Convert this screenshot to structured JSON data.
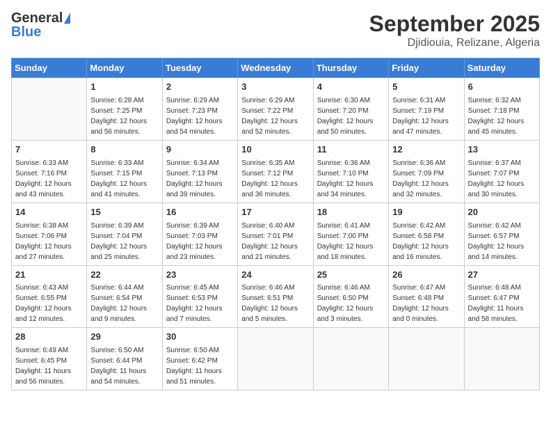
{
  "logo": {
    "general": "General",
    "blue": "Blue"
  },
  "title": "September 2025",
  "location": "Djidiouia, Relizane, Algeria",
  "days_of_week": [
    "Sunday",
    "Monday",
    "Tuesday",
    "Wednesday",
    "Thursday",
    "Friday",
    "Saturday"
  ],
  "weeks": [
    [
      {
        "day": "",
        "info": ""
      },
      {
        "day": "1",
        "info": "Sunrise: 6:28 AM\nSunset: 7:25 PM\nDaylight: 12 hours\nand 56 minutes."
      },
      {
        "day": "2",
        "info": "Sunrise: 6:29 AM\nSunset: 7:23 PM\nDaylight: 12 hours\nand 54 minutes."
      },
      {
        "day": "3",
        "info": "Sunrise: 6:29 AM\nSunset: 7:22 PM\nDaylight: 12 hours\nand 52 minutes."
      },
      {
        "day": "4",
        "info": "Sunrise: 6:30 AM\nSunset: 7:20 PM\nDaylight: 12 hours\nand 50 minutes."
      },
      {
        "day": "5",
        "info": "Sunrise: 6:31 AM\nSunset: 7:19 PM\nDaylight: 12 hours\nand 47 minutes."
      },
      {
        "day": "6",
        "info": "Sunrise: 6:32 AM\nSunset: 7:18 PM\nDaylight: 12 hours\nand 45 minutes."
      }
    ],
    [
      {
        "day": "7",
        "info": "Sunrise: 6:33 AM\nSunset: 7:16 PM\nDaylight: 12 hours\nand 43 minutes."
      },
      {
        "day": "8",
        "info": "Sunrise: 6:33 AM\nSunset: 7:15 PM\nDaylight: 12 hours\nand 41 minutes."
      },
      {
        "day": "9",
        "info": "Sunrise: 6:34 AM\nSunset: 7:13 PM\nDaylight: 12 hours\nand 39 minutes."
      },
      {
        "day": "10",
        "info": "Sunrise: 6:35 AM\nSunset: 7:12 PM\nDaylight: 12 hours\nand 36 minutes."
      },
      {
        "day": "11",
        "info": "Sunrise: 6:36 AM\nSunset: 7:10 PM\nDaylight: 12 hours\nand 34 minutes."
      },
      {
        "day": "12",
        "info": "Sunrise: 6:36 AM\nSunset: 7:09 PM\nDaylight: 12 hours\nand 32 minutes."
      },
      {
        "day": "13",
        "info": "Sunrise: 6:37 AM\nSunset: 7:07 PM\nDaylight: 12 hours\nand 30 minutes."
      }
    ],
    [
      {
        "day": "14",
        "info": "Sunrise: 6:38 AM\nSunset: 7:06 PM\nDaylight: 12 hours\nand 27 minutes."
      },
      {
        "day": "15",
        "info": "Sunrise: 6:39 AM\nSunset: 7:04 PM\nDaylight: 12 hours\nand 25 minutes."
      },
      {
        "day": "16",
        "info": "Sunrise: 6:39 AM\nSunset: 7:03 PM\nDaylight: 12 hours\nand 23 minutes."
      },
      {
        "day": "17",
        "info": "Sunrise: 6:40 AM\nSunset: 7:01 PM\nDaylight: 12 hours\nand 21 minutes."
      },
      {
        "day": "18",
        "info": "Sunrise: 6:41 AM\nSunset: 7:00 PM\nDaylight: 12 hours\nand 18 minutes."
      },
      {
        "day": "19",
        "info": "Sunrise: 6:42 AM\nSunset: 6:58 PM\nDaylight: 12 hours\nand 16 minutes."
      },
      {
        "day": "20",
        "info": "Sunrise: 6:42 AM\nSunset: 6:57 PM\nDaylight: 12 hours\nand 14 minutes."
      }
    ],
    [
      {
        "day": "21",
        "info": "Sunrise: 6:43 AM\nSunset: 6:55 PM\nDaylight: 12 hours\nand 12 minutes."
      },
      {
        "day": "22",
        "info": "Sunrise: 6:44 AM\nSunset: 6:54 PM\nDaylight: 12 hours\nand 9 minutes."
      },
      {
        "day": "23",
        "info": "Sunrise: 6:45 AM\nSunset: 6:53 PM\nDaylight: 12 hours\nand 7 minutes."
      },
      {
        "day": "24",
        "info": "Sunrise: 6:46 AM\nSunset: 6:51 PM\nDaylight: 12 hours\nand 5 minutes."
      },
      {
        "day": "25",
        "info": "Sunrise: 6:46 AM\nSunset: 6:50 PM\nDaylight: 12 hours\nand 3 minutes."
      },
      {
        "day": "26",
        "info": "Sunrise: 6:47 AM\nSunset: 6:48 PM\nDaylight: 12 hours\nand 0 minutes."
      },
      {
        "day": "27",
        "info": "Sunrise: 6:48 AM\nSunset: 6:47 PM\nDaylight: 11 hours\nand 58 minutes."
      }
    ],
    [
      {
        "day": "28",
        "info": "Sunrise: 6:49 AM\nSunset: 6:45 PM\nDaylight: 11 hours\nand 56 minutes."
      },
      {
        "day": "29",
        "info": "Sunrise: 6:50 AM\nSunset: 6:44 PM\nDaylight: 11 hours\nand 54 minutes."
      },
      {
        "day": "30",
        "info": "Sunrise: 6:50 AM\nSunset: 6:42 PM\nDaylight: 11 hours\nand 51 minutes."
      },
      {
        "day": "",
        "info": ""
      },
      {
        "day": "",
        "info": ""
      },
      {
        "day": "",
        "info": ""
      },
      {
        "day": "",
        "info": ""
      }
    ]
  ]
}
